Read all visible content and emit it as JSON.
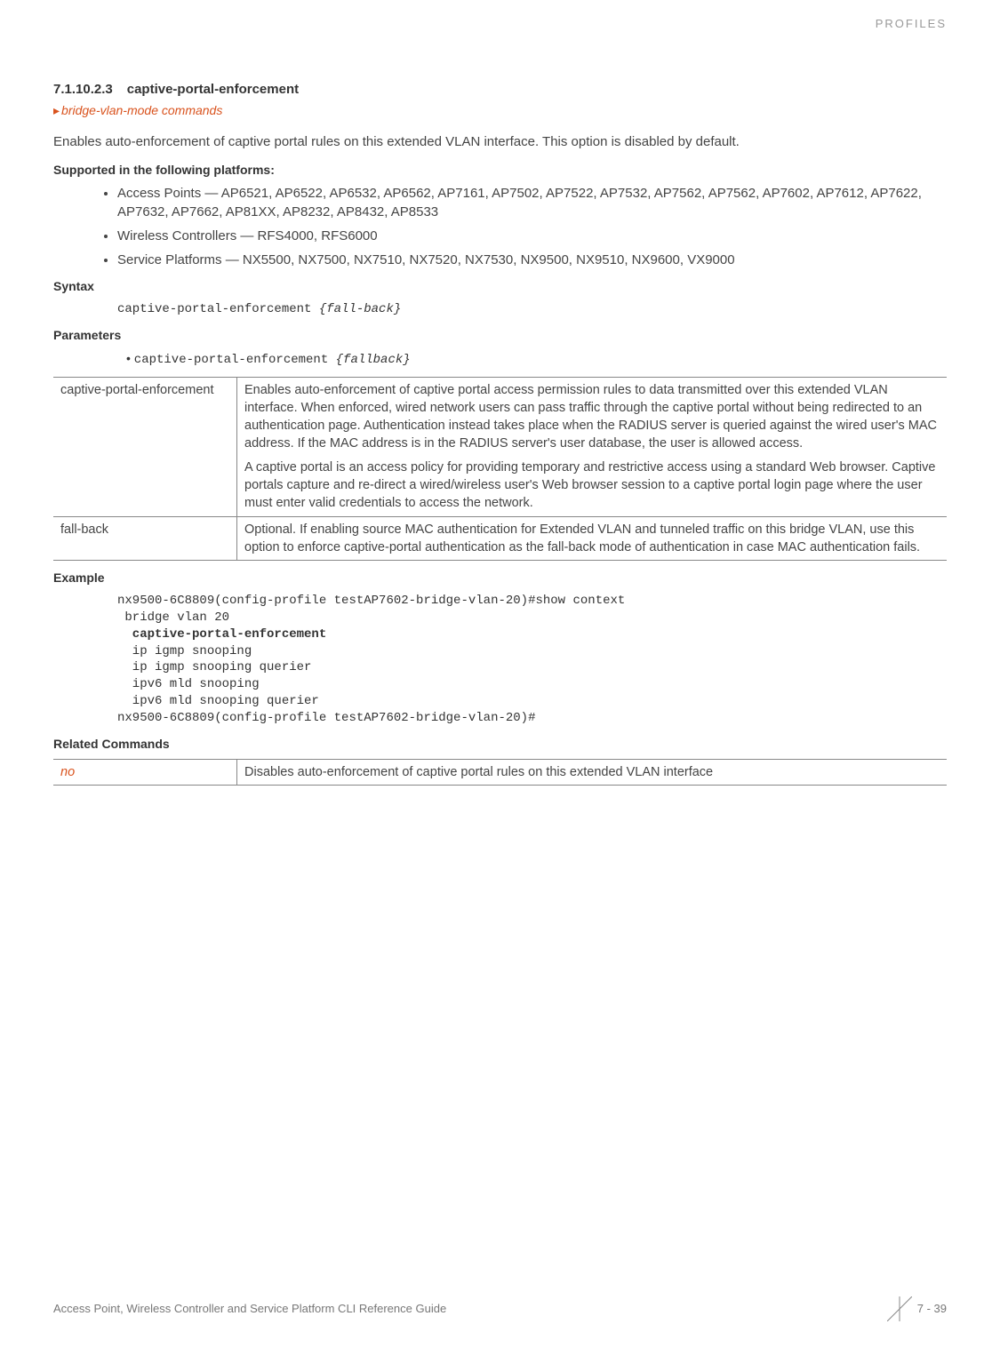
{
  "header": {
    "category": "PROFILES"
  },
  "section": {
    "number": "7.1.10.2.3",
    "title": "captive-portal-enforcement",
    "breadcrumb": "bridge-vlan-mode commands",
    "intro": "Enables auto-enforcement of captive portal rules on this extended VLAN interface. This option is disabled by default."
  },
  "supported": {
    "heading": "Supported in the following platforms:",
    "items": [
      "Access Points — AP6521, AP6522, AP6532, AP6562, AP7161, AP7502, AP7522, AP7532, AP7562, AP7562, AP7602, AP7612, AP7622, AP7632, AP7662, AP81XX, AP8232, AP8432, AP8533",
      "Wireless Controllers — RFS4000, RFS6000",
      "Service Platforms — NX5500, NX7500, NX7510, NX7520, NX7530, NX9500, NX9510, NX9600, VX9000"
    ]
  },
  "syntax": {
    "heading": "Syntax",
    "code_plain": "captive-portal-enforcement ",
    "code_italic": "{fall-back}"
  },
  "parameters": {
    "heading": "Parameters",
    "bullet_plain": "captive-portal-enforcement ",
    "bullet_italic": "{fallback}",
    "rows": [
      {
        "name": "captive-portal-enforcement",
        "desc1": "Enables auto-enforcement of captive portal access permission rules to data transmitted over this extended VLAN interface. When enforced, wired network users can pass traffic through the captive portal without being redirected to an authentication page. Authentication instead takes place when the RADIUS server is queried against the wired user's MAC address. If the MAC address is in the RADIUS server's user database, the user is allowed access.",
        "desc2": "A captive portal is an access policy for providing temporary and restrictive access using a standard Web browser. Captive portals capture and re-direct a wired/wireless user's Web browser session to a captive portal login page where the user must enter valid credentials to access the network."
      },
      {
        "name": "fall-back",
        "desc1": "Optional. If enabling source MAC authentication for Extended VLAN and tunneled traffic on this bridge VLAN, use this option to enforce captive-portal authentication as the fall-back mode of authentication in case MAC authentication fails."
      }
    ]
  },
  "example": {
    "heading": "Example",
    "line1": "nx9500-6C8809(config-profile testAP7602-bridge-vlan-20)#show context",
    "line2": " bridge vlan 20",
    "line3_bold": "  captive-portal-enforcement",
    "line4": "  ip igmp snooping",
    "line5": "  ip igmp snooping querier",
    "line6": "  ipv6 mld snooping",
    "line7": "  ipv6 mld snooping querier",
    "line8": "nx9500-6C8809(config-profile testAP7602-bridge-vlan-20)#"
  },
  "related": {
    "heading": "Related Commands",
    "rows": [
      {
        "cmd": "no",
        "desc": "Disables auto-enforcement of captive portal rules on this extended VLAN interface"
      }
    ]
  },
  "footer": {
    "title": "Access Point, Wireless Controller and Service Platform CLI Reference Guide",
    "page": "7 - 39"
  }
}
